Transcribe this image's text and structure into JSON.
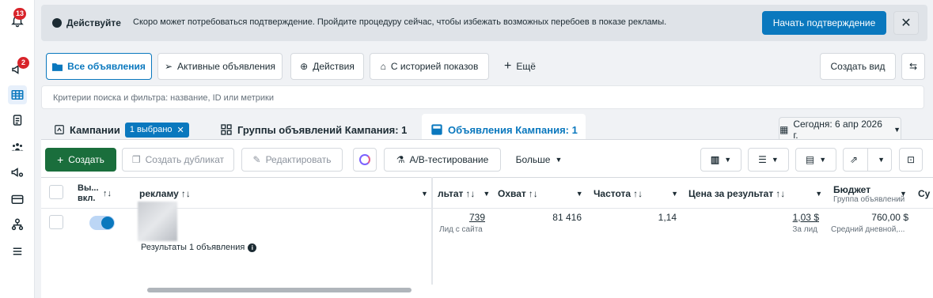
{
  "sidebar": {
    "notifications_badge": "13",
    "alerts_badge": "2",
    "items": [
      {
        "icon": "bell-icon"
      },
      {
        "icon": "megaphone-alert-icon"
      },
      {
        "icon": "table-grid-icon",
        "active": true
      },
      {
        "icon": "clipboard-icon"
      },
      {
        "icon": "audience-icon"
      },
      {
        "icon": "megaphone-gear-icon"
      },
      {
        "icon": "billing-card-icon"
      },
      {
        "icon": "org-chart-icon"
      },
      {
        "icon": "menu-icon"
      }
    ]
  },
  "banner": {
    "title": "Действуйте",
    "text": "Скоро может потребоваться подтверждение. Пройдите процедуру сейчас, чтобы избежать возможных перебоев в показе рекламы.",
    "action": "Начать подтверждение"
  },
  "view_tabs": {
    "all": "Все объявления",
    "active": "Активные объявления",
    "actions": "Действия",
    "history": "С историей показов",
    "more": "Ещё",
    "create_view": "Создать вид"
  },
  "search": {
    "placeholder": "Критерии поиска и фильтра: название, ID или метрики"
  },
  "levels": {
    "campaigns": "Кампании",
    "selected": "1 выбрано",
    "adsets": "Группы объявлений Кампания: 1",
    "ads": "Объявления Кампания: 1",
    "date": "Сегодня: 6 апр 2026 г."
  },
  "toolbar": {
    "create": "Создать",
    "duplicate": "Создать дубликат",
    "edit": "Редактировать",
    "ab_test": "A/B-тестирование",
    "more": "Больше"
  },
  "columns": {
    "onoff": "Вы... вкл.",
    "ad": "рекламу",
    "result": "льтат",
    "reach": "Охват",
    "frequency": "Частота",
    "cost": "Цена за результат",
    "budget": "Бюджет",
    "budget_sub": "Группа объявлений",
    "next": "Су"
  },
  "row": {
    "result": "739",
    "result_sub": "Лид с сайта",
    "reach": "81 416",
    "frequency": "1,14",
    "cost": "1,03 $",
    "cost_sub": "За лид",
    "budget": "760,00 $",
    "budget_sub": "Средний дневной,..."
  },
  "footer": {
    "results": "Результаты 1 объявления"
  },
  "colors": {
    "accent": "#0a78be",
    "green": "#1a6e3c",
    "badge": "#d8232a"
  }
}
